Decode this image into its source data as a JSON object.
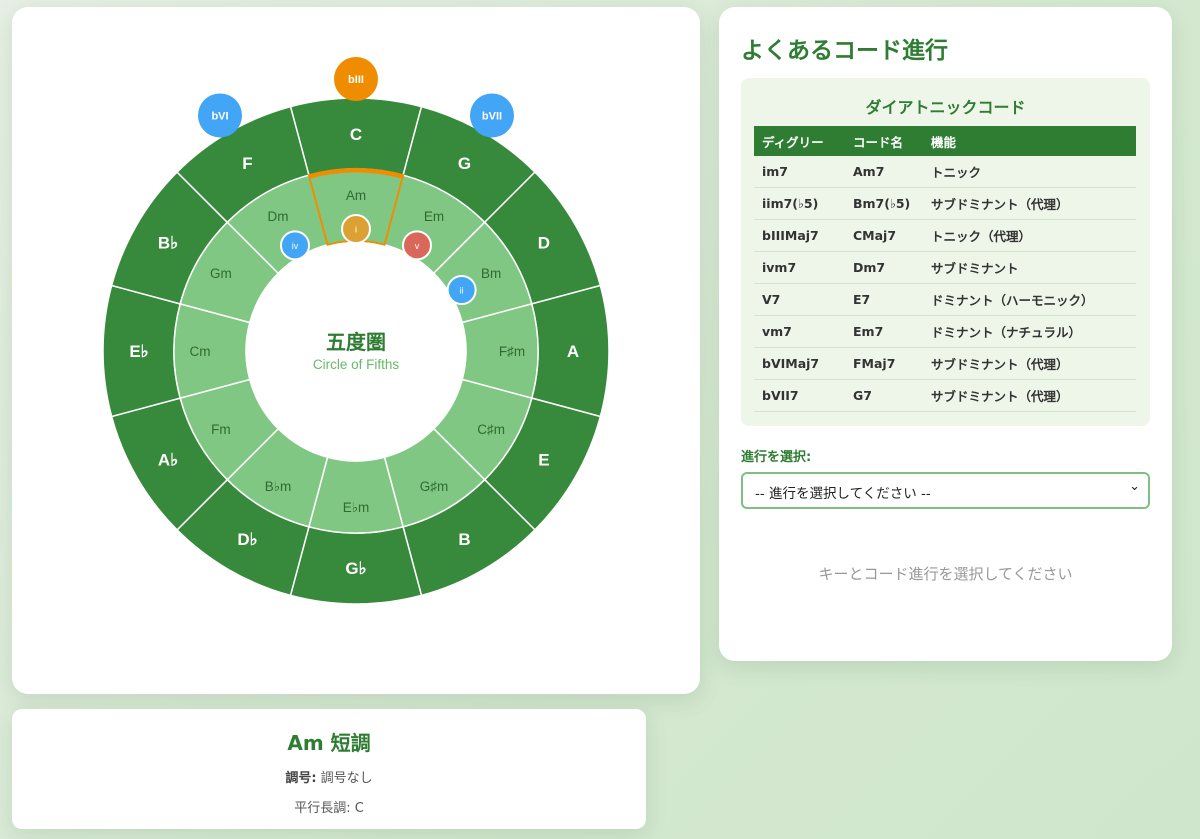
{
  "wheel": {
    "center_title": "五度圏",
    "center_subtitle": "Circle of Fifths",
    "major_keys": [
      "C",
      "G",
      "D",
      "A",
      "E",
      "B",
      "G♭",
      "D♭",
      "A♭",
      "E♭",
      "B♭",
      "F"
    ],
    "minor_keys": [
      "Am",
      "Em",
      "Bm",
      "F♯m",
      "C♯m",
      "G♯m",
      "E♭m",
      "B♭m",
      "Fm",
      "Cm",
      "Gm",
      "Dm"
    ],
    "selected_minor_index": 0,
    "inner_markers": [
      {
        "label": "i",
        "index": 0,
        "color": "#dba133"
      },
      {
        "label": "v",
        "index": 1,
        "color": "#d9685a"
      },
      {
        "label": "ii",
        "index": 2,
        "color": "#42a5f5"
      },
      {
        "label": "iv",
        "index": 11,
        "color": "#42a5f5"
      }
    ],
    "outer_markers": [
      {
        "label": "bIII",
        "index": 0,
        "color": "#ef8c00"
      },
      {
        "label": "bVII",
        "index": 1,
        "color": "#42a5f5"
      },
      {
        "label": "bVI",
        "index": 11,
        "color": "#42a5f5"
      }
    ],
    "colors": {
      "outer_ring": "#37893b",
      "inner_ring": "#81c784",
      "divider": "#ffffff",
      "highlight": "#ef8c00",
      "center_text": "#2e7d32",
      "center_sub": "#66bb6a"
    }
  },
  "key_info": {
    "title": "Am 短調",
    "signature_label": "調号:",
    "signature_value": "調号なし",
    "relative_label": "平行長調:",
    "relative_value": "C"
  },
  "progression_panel": {
    "title": "よくあるコード進行",
    "diatonic": {
      "title": "ダイアトニックコード",
      "headers": [
        "ディグリー",
        "コード名",
        "機能"
      ],
      "rows": [
        [
          "im7",
          "Am7",
          "トニック"
        ],
        [
          "iim7(♭5)",
          "Bm7(♭5)",
          "サブドミナント（代理）"
        ],
        [
          "bIIIMaj7",
          "CMaj7",
          "トニック（代理）"
        ],
        [
          "ivm7",
          "Dm7",
          "サブドミナント"
        ],
        [
          "V7",
          "E7",
          "ドミナント（ハーモニック）"
        ],
        [
          "vm7",
          "Em7",
          "ドミナント（ナチュラル）"
        ],
        [
          "bVIMaj7",
          "FMaj7",
          "サブドミナント（代理）"
        ],
        [
          "bVII7",
          "G7",
          "サブドミナント（代理）"
        ]
      ]
    },
    "select_label": "進行を選択:",
    "select_value": "-- 進行を選択してください --",
    "placeholder": "キーとコード進行を選択してください"
  }
}
